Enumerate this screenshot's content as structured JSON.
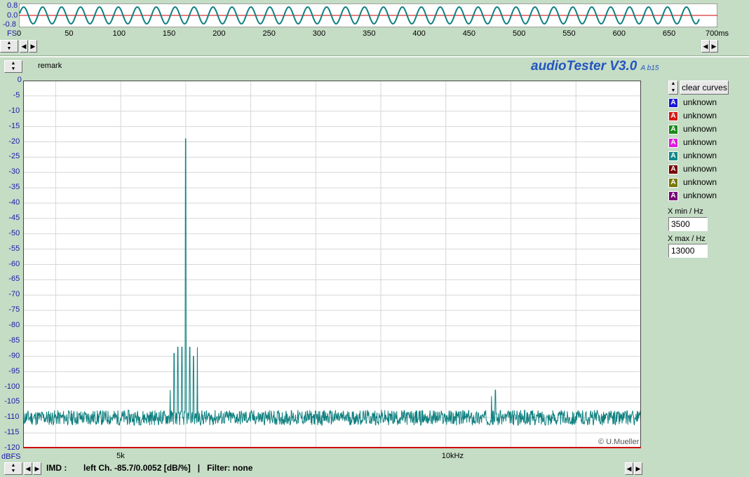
{
  "top_scope": {
    "y_labels": [
      "0.8",
      "0.0",
      "-0.8"
    ],
    "fs_label": "FS",
    "x_ticks": [
      "0",
      "50",
      "100",
      "150",
      "200",
      "250",
      "300",
      "350",
      "400",
      "450",
      "500",
      "550",
      "600",
      "650"
    ],
    "x_end_label": "700ms"
  },
  "app": {
    "remark_label": "remark",
    "title": "audioTester V3.0",
    "version_sub": "A b15",
    "copyright": "© U.Mueller"
  },
  "legend": {
    "clear_label": "clear curves",
    "items": [
      {
        "glyph": "A",
        "label": "unknown",
        "color": "#1818d8"
      },
      {
        "glyph": "A",
        "label": "unknown",
        "color": "#d81818"
      },
      {
        "glyph": "A",
        "label": "unknown",
        "color": "#188818"
      },
      {
        "glyph": "A",
        "label": "unknown",
        "color": "#e018e0"
      },
      {
        "glyph": "A",
        "label": "unknown",
        "color": "#108888"
      },
      {
        "glyph": "A",
        "label": "unknown",
        "color": "#780000"
      },
      {
        "glyph": "A",
        "label": "unknown",
        "color": "#787800"
      },
      {
        "glyph": "A",
        "label": "unknown",
        "color": "#780078"
      }
    ],
    "xmin_label": "X min / Hz",
    "xmin_value": "3500",
    "xmax_label": "X max / Hz",
    "xmax_value": "13000"
  },
  "status": {
    "measure": "IMD :",
    "result": "left Ch. -85.7/0.0052 [dB/%]   |   Filter: none"
  },
  "chart_data": {
    "type": "line",
    "ylabel": "dBFS",
    "xlim": [
      3500,
      13000
    ],
    "ylim": [
      -120,
      0
    ],
    "y_ticks": [
      "0",
      "-5",
      "-10",
      "-15",
      "-20",
      "-25",
      "-30",
      "-35",
      "-40",
      "-45",
      "-50",
      "-55",
      "-60",
      "-65",
      "-70",
      "-75",
      "-80",
      "-85",
      "-90",
      "-95",
      "-100",
      "-105",
      "-110",
      "-115",
      "-120"
    ],
    "x_tick_labels": [
      {
        "x": 5000,
        "label": "5k"
      },
      {
        "x": 10000,
        "label": "10kHz"
      }
    ],
    "noise_floor_db": -110,
    "peaks": [
      {
        "x": 6000,
        "y": -19
      },
      {
        "x": 5940,
        "y": -87
      },
      {
        "x": 5880,
        "y": -87
      },
      {
        "x": 6060,
        "y": -87
      },
      {
        "x": 6120,
        "y": -90
      },
      {
        "x": 6180,
        "y": -87
      },
      {
        "x": 5820,
        "y": -89
      },
      {
        "x": 5760,
        "y": -101
      },
      {
        "x": 10700,
        "y": -103
      },
      {
        "x": 10760,
        "y": -101
      }
    ],
    "curve_color": "#108080"
  }
}
